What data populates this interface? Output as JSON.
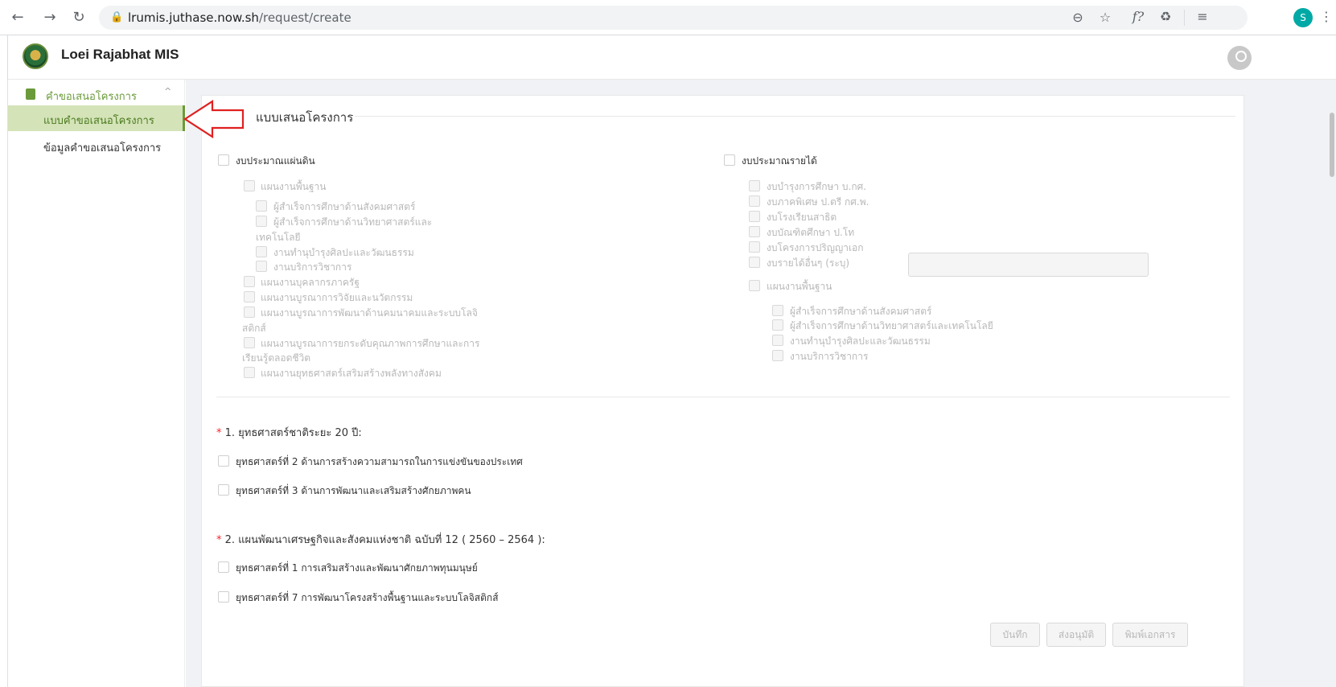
{
  "browser": {
    "url_host": "lrumis.juthase.now.sh",
    "url_path": "/request/create",
    "profile_initial": "S",
    "back_glyph": "←",
    "forward_glyph": "→",
    "reload_glyph": "↻",
    "lock_glyph": "🔒",
    "zoom_glyph": "⊖",
    "star_glyph": "☆",
    "fx_glyph": "f?",
    "recycle_glyph": "♻",
    "media_glyph": "≡",
    "menu_glyph": "⋮"
  },
  "app": {
    "title": "Loei Rajabhat MIS"
  },
  "sidebar": {
    "group_label": "คำขอเสนอโครงการ",
    "chevron": "^",
    "items": [
      {
        "label": "แบบคำขอเสนอโครงการ",
        "active": true
      },
      {
        "label": "ข้อมูลคำขอเสนอโครงการ",
        "active": false
      }
    ]
  },
  "form": {
    "card_title": "แบบเสนอโครงการ",
    "left_budget": {
      "label": "งบประมาณแผ่นดิน",
      "items": [
        "แผนงานพื้นฐาน",
        "ผู้สำเร็จการศึกษาด้านสังคมศาสตร์",
        "ผู้สำเร็จการศึกษาด้านวิทยาศาสตร์และ",
        "เทคโนโลยี",
        "งานทำนุบำรุงศิลปะและวัฒนธรรม",
        "งานบริการวิชาการ",
        "แผนงานบุคลากรภาครัฐ",
        "แผนงานบูรณาการวิจัยและนวัตกรรม",
        "แผนงานบูรณาการพัฒนาด้านคมนาคมและระบบโลจิ",
        "สติกส์",
        "แผนงานบูรณาการยกระดับคุณภาพการศึกษาและการ",
        "เรียนรู้ตลอดชีวิต",
        "แผนงานยุทธศาสตร์เสริมสร้างพลังทางสังคม"
      ]
    },
    "right_budget": {
      "label": "งบประมาณรายได้",
      "items": [
        "งบบำรุงการศึกษา บ.กศ.",
        "งบภาคพิเศษ ป.ตรี กศ.พ.",
        "งบโรงเรียนสาธิต",
        "งบบัณฑิตศึกษา ป.โท",
        "งบโครงการปริญญาเอก",
        "งบรายได้อื่นๆ (ระบุ)",
        "แผนงานพื้นฐาน",
        "ผู้สำเร็จการศึกษาด้านสังคมศาสตร์",
        "ผู้สำเร็จการศึกษาด้านวิทยาศาสตร์และเทคโนโลยี",
        "งานทำนุบำรุงศิลปะและวัฒนธรรม",
        "งานบริการวิชาการ"
      ],
      "other_value": ""
    },
    "q1": {
      "asterisk": "*",
      "label": "1. ยุทธศาสตร์ชาติระยะ 20 ปี:",
      "options": [
        "ยุทธศาสตร์ที่ 2 ด้านการสร้างความสามารถในการแข่งขันของประเทศ",
        "ยุทธศาสตร์ที่ 3 ด้านการพัฒนาและเสริมสร้างศักยภาพคน"
      ]
    },
    "q2": {
      "asterisk": "*",
      "label": "2. แผนพัฒนาเศรษฐกิจและสังคมแห่งชาติ ฉบับที่ 12 ( 2560 – 2564 ):",
      "options": [
        "ยุทธศาสตร์ที่ 1 การเสริมสร้างและพัฒนาศักยภาพทุนมนุษย์",
        "ยุทธศาสตร์ที่ 7 การพัฒนาโครงสร้างพื้นฐานและระบบโลจิสติกส์"
      ]
    },
    "buttons": {
      "save": "บันทึก",
      "submit": "ส่งอนุมัติ",
      "print": "พิมพ์เอกสาร"
    }
  },
  "colors": {
    "accent": "#6a9a3a",
    "active_bg": "#d4e3b8",
    "annotation": "#e02020"
  }
}
